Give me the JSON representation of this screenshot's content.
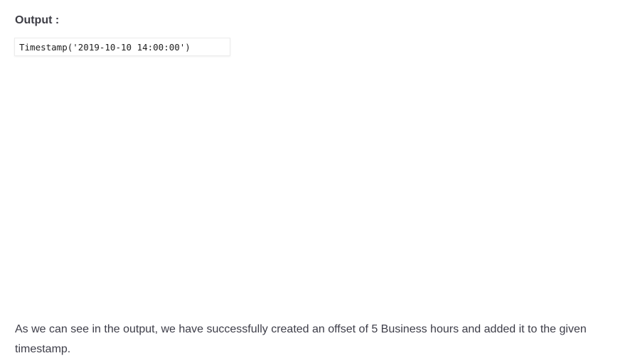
{
  "output_section": {
    "heading": "Output :",
    "code": "Timestamp('2019-10-10 14:00:00')"
  },
  "explanation": {
    "text": "As we can see in the output, we have successfully created an offset of 5 Business hours and added it to the given timestamp."
  }
}
